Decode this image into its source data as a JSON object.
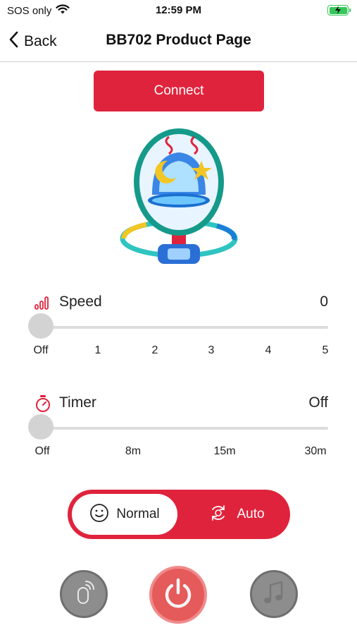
{
  "status_bar": {
    "carrier": "SOS only",
    "time": "12:59 PM"
  },
  "nav": {
    "back_label": "Back",
    "title": "BB702 Product Page"
  },
  "connect": {
    "label": "Connect"
  },
  "speed": {
    "label": "Speed",
    "value": "0",
    "ticks": [
      "Off",
      "1",
      "2",
      "3",
      "4",
      "5"
    ]
  },
  "timer": {
    "label": "Timer",
    "value": "Off",
    "ticks": [
      "Off",
      "8m",
      "15m",
      "30m"
    ]
  },
  "mode": {
    "normal_label": "Normal",
    "auto_label": "Auto",
    "selected": "Normal"
  },
  "colors": {
    "accent": "#e0233c",
    "battery": "#34c759",
    "disabled_button": "#8d8d8d"
  },
  "icons": {
    "wifi": "wifi-icon",
    "battery": "battery-charging-icon",
    "back": "chevron-left-icon",
    "speed": "signal-bars-icon",
    "timer": "stopwatch-icon",
    "normal": "smiley-icon",
    "auto": "auto-cycle-icon",
    "remote": "remote-control-icon",
    "power": "power-icon",
    "music": "music-note-icon"
  }
}
